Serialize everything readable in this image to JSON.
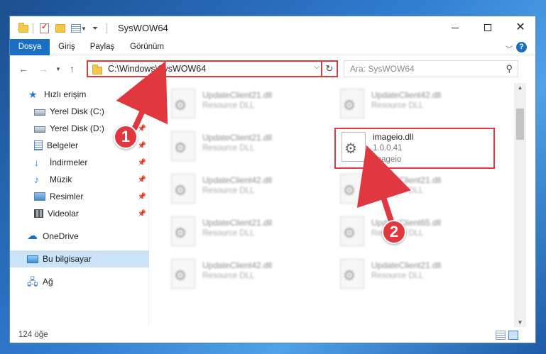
{
  "window": {
    "title": "SysWOW64"
  },
  "ribbon": {
    "tabs": [
      "Dosya",
      "Giriş",
      "Paylaş",
      "Görünüm"
    ]
  },
  "address": {
    "path": "C:\\Windows\\SysWOW64",
    "search_placeholder": "Ara: SysWOW64"
  },
  "sidebar": {
    "items": [
      {
        "label": "Hızlı erişim",
        "icon": "star-icon"
      },
      {
        "label": "Yerel Disk (C:)",
        "icon": "disk-icon"
      },
      {
        "label": "Yerel Disk (D:)",
        "icon": "disk-icon"
      },
      {
        "label": "Belgeler",
        "icon": "document-icon"
      },
      {
        "label": "İndirmeler",
        "icon": "download-icon"
      },
      {
        "label": "Müzik",
        "icon": "music-icon"
      },
      {
        "label": "Resimler",
        "icon": "pictures-icon"
      },
      {
        "label": "Videolar",
        "icon": "video-icon"
      },
      {
        "label": "OneDrive",
        "icon": "cloud-icon"
      },
      {
        "label": "Bu bilgisayar",
        "icon": "computer-icon"
      },
      {
        "label": "Ağ",
        "icon": "network-icon"
      }
    ]
  },
  "files": [
    {
      "name": "UpdateClient21.dll",
      "sub": "Resource DLL"
    },
    {
      "name": "UpdateClient42.dll",
      "sub": "Resource DLL"
    },
    {
      "name": "UpdateClient21.dll",
      "sub": "Resource DLL"
    },
    {
      "name": "imageio.dll",
      "sub": "1.0.0.41",
      "sub2": "imageio"
    },
    {
      "name": "UpdateClient42.dll",
      "sub": "Resource DLL"
    },
    {
      "name": "UpdateClient21.dll",
      "sub": "Resource DLL"
    },
    {
      "name": "UpdateClient21.dll",
      "sub": "Resource DLL"
    },
    {
      "name": "UpdateClient65.dll",
      "sub": "Resource DLL"
    },
    {
      "name": "UpdateClient42.dll",
      "sub": "Resource DLL"
    },
    {
      "name": "UpdateClient21.dll",
      "sub": "Resource DLL"
    }
  ],
  "status": {
    "count": "124 öğe"
  },
  "annotations": {
    "step1": "1",
    "step2": "2"
  },
  "colors": {
    "accent": "#1a6fc4",
    "highlight": "#e0383e",
    "selected": "#cce3f7"
  }
}
